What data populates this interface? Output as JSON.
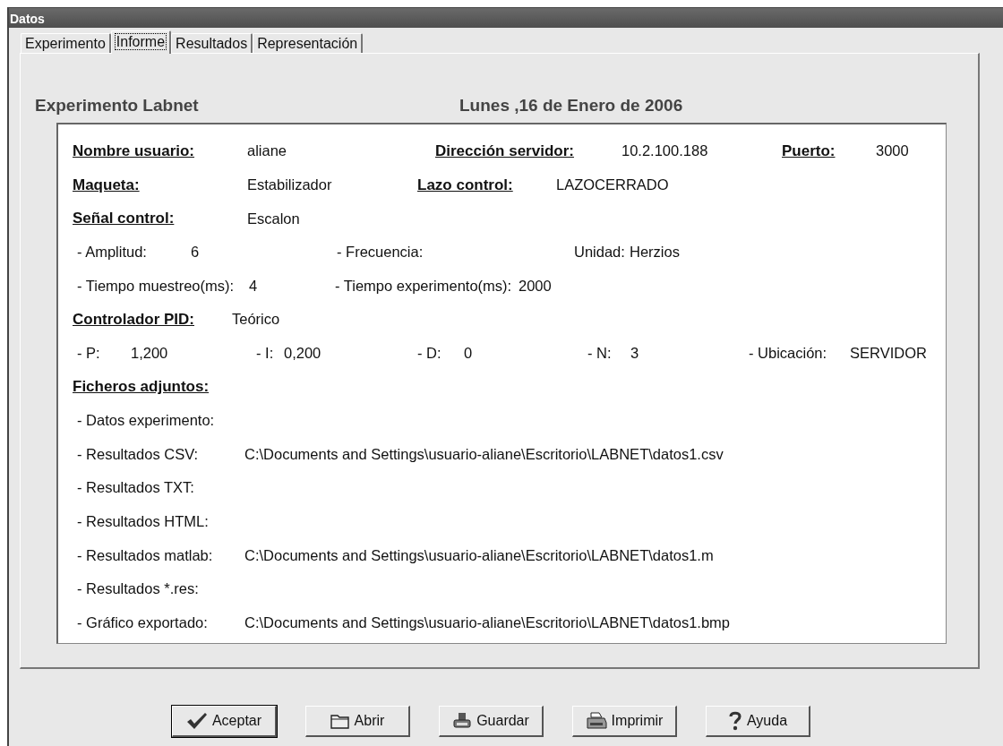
{
  "window": {
    "title": "Datos"
  },
  "tabs": [
    {
      "label": "Experimento",
      "selected": false
    },
    {
      "label": "Informe",
      "selected": true
    },
    {
      "label": "Resultados",
      "selected": false
    },
    {
      "label": "Representación",
      "selected": false
    }
  ],
  "report": {
    "title": "Experimento Labnet",
    "date": "Lunes ,16 de Enero de 2006"
  },
  "rows": [
    {
      "kind": "heading",
      "fields": [
        {
          "label": "Nombre usuario:",
          "value": "aliane"
        },
        {
          "label": "Dirección servidor:",
          "value": "10.2.100.188"
        },
        {
          "label": "Puerto:",
          "value": "3000"
        }
      ]
    },
    {
      "kind": "heading",
      "fields": [
        {
          "label": "Maqueta:",
          "value": "Estabilizador"
        },
        {
          "label": "Lazo control:",
          "value": "LAZOCERRADO"
        }
      ]
    },
    {
      "kind": "heading",
      "fields": [
        {
          "label": "Señal control:",
          "value": "Escalon"
        }
      ]
    },
    {
      "kind": "detail",
      "fields": [
        {
          "label": "- Amplitud:",
          "value": "6"
        },
        {
          "label": "- Frecuencia:"
        },
        {
          "label": "Unidad:",
          "value": "Herzios"
        }
      ]
    },
    {
      "kind": "detail",
      "fields": [
        {
          "label": "- Tiempo muestreo(ms):",
          "value": "4"
        },
        {
          "label": "- Tiempo experimento(ms):",
          "value": "2000"
        }
      ]
    },
    {
      "kind": "heading",
      "fields": [
        {
          "label": "Controlador PID:",
          "value": "Teórico"
        }
      ]
    },
    {
      "kind": "detail",
      "fields": [
        {
          "label": "- P:",
          "value": "1,200"
        },
        {
          "label": "- I:",
          "value": "0,200"
        },
        {
          "label": "- D:",
          "value": "0"
        },
        {
          "label": "- N:",
          "value": "3"
        },
        {
          "label": "- Ubicación:",
          "value": "SERVIDOR"
        }
      ]
    },
    {
      "kind": "heading",
      "fields": [
        {
          "label": "Ficheros adjuntos:"
        }
      ]
    },
    {
      "kind": "detail",
      "fields": [
        {
          "label": "- Datos experimento:"
        }
      ]
    },
    {
      "kind": "detail",
      "fields": [
        {
          "label": "- Resultados CSV:",
          "value": "C:\\Documents and Settings\\usuario-aliane\\Escritorio\\LABNET\\datos1.csv"
        }
      ]
    },
    {
      "kind": "detail",
      "fields": [
        {
          "label": "- Resultados TXT:"
        }
      ]
    },
    {
      "kind": "detail",
      "fields": [
        {
          "label": "- Resultados HTML:"
        }
      ]
    },
    {
      "kind": "detail",
      "fields": [
        {
          "label": "- Resultados matlab:",
          "value": "C:\\Documents and Settings\\usuario-aliane\\Escritorio\\LABNET\\datos1.m"
        }
      ]
    },
    {
      "kind": "detail",
      "fields": [
        {
          "label": "- Resultados *.res:"
        }
      ]
    },
    {
      "kind": "detail",
      "fields": [
        {
          "label": "- Gráfico exportado:",
          "value": "C:\\Documents and Settings\\usuario-aliane\\Escritorio\\LABNET\\datos1.bmp"
        }
      ]
    }
  ],
  "buttons": [
    {
      "label": "Aceptar",
      "default": true
    },
    {
      "label": "Abrir",
      "default": false
    },
    {
      "label": "Guardar",
      "default": false
    },
    {
      "label": "Imprimir",
      "default": false
    },
    {
      "label": "Ayuda",
      "default": false
    }
  ]
}
